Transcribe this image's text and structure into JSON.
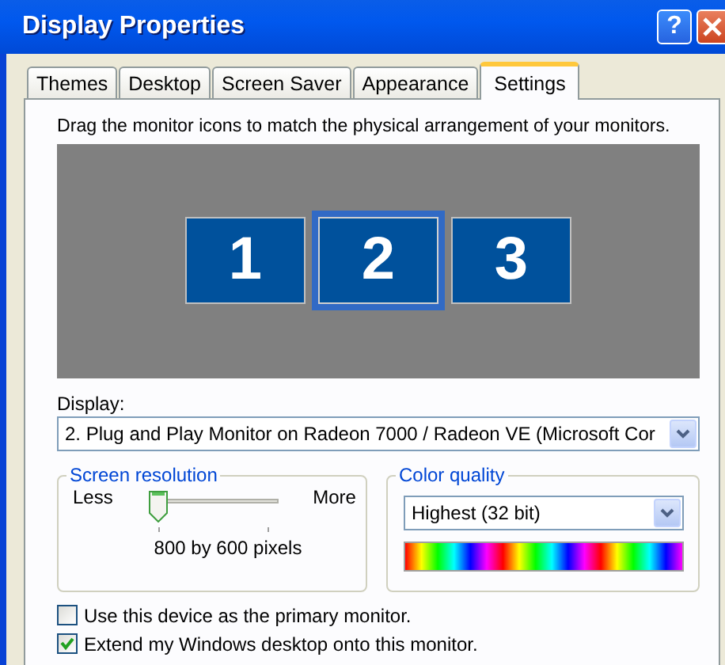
{
  "window": {
    "title": "Display Properties",
    "buttons": [
      {
        "kind": "help",
        "glyph": "?"
      },
      {
        "kind": "close"
      }
    ]
  },
  "tabs": [
    {
      "label": "Themes",
      "selected": false
    },
    {
      "label": "Desktop",
      "selected": false
    },
    {
      "label": "Screen Saver",
      "selected": false
    },
    {
      "label": "Appearance",
      "selected": false
    },
    {
      "label": "Settings",
      "selected": true
    }
  ],
  "instructions": "Drag the monitor icons to match the physical arrangement of your monitors.",
  "monitors": [
    {
      "label": "1",
      "selected": false
    },
    {
      "label": "2",
      "selected": true
    },
    {
      "label": "3",
      "selected": false
    }
  ],
  "display": {
    "label": "Display:",
    "value": "2. Plug and Play Monitor on Radeon 7000 / Radeon VE (Microsoft Cor"
  },
  "screen_resolution": {
    "title": "Screen resolution",
    "min_label": "Less",
    "max_label": "More",
    "level": 0,
    "reading": "800 by 600 pixels"
  },
  "color_quality": {
    "title": "Color quality",
    "value": "Highest (32 bit)"
  },
  "checkboxes": [
    {
      "label": "Use this device as the primary monitor.",
      "checked": false
    },
    {
      "label": "Extend my Windows desktop onto this monitor.",
      "checked": true
    }
  ]
}
